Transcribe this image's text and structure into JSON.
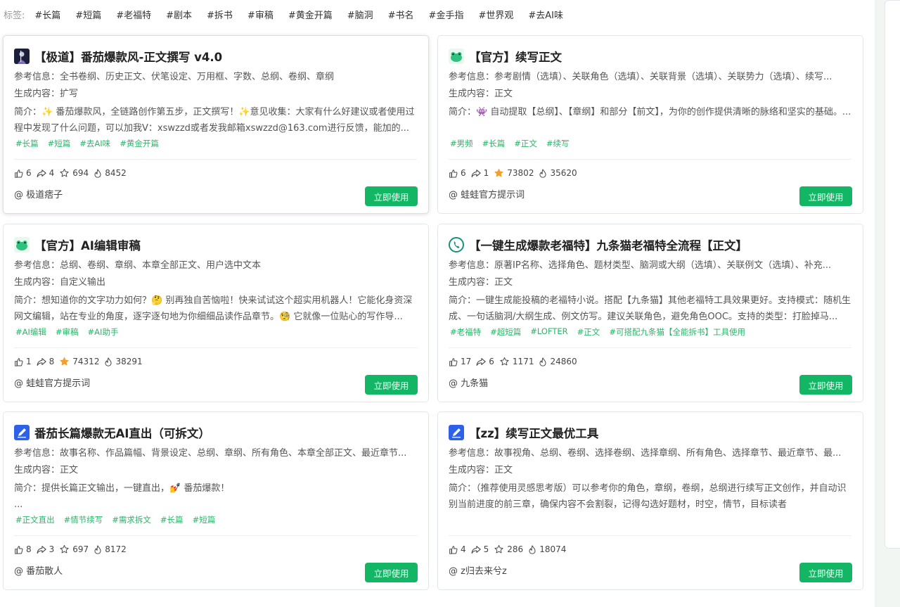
{
  "tags_bar": {
    "label": "标签:",
    "tags": [
      "#长篇",
      "#短篇",
      "#老福特",
      "#剧本",
      "#拆书",
      "#审稿",
      "#黄金开篇",
      "#脑洞",
      "#书名",
      "#金手指",
      "#世界观",
      "#去AI味"
    ]
  },
  "labels": {
    "ref": "参考信息：",
    "gen": "生成内容：",
    "intro": "简介：",
    "use_button": "立即使用"
  },
  "cards": [
    {
      "title": "【极道】番茄爆款风-正文撰写 v4.0",
      "icon": "dark-portrait-icon",
      "ref": "全书卷纲、历史正文、伏笔设定、万用框、字数、总纲、卷纲、章纲",
      "gen": "扩写",
      "intro": "✨ 番茄爆款风，全链路创作第五步，正文撰写！✨意见收集：大家有什么好建议或者使用过程中发现了什么问题，可以加我V：xswzzd或者发我邮箱xswzzd@163.com进行反馈，能加的...",
      "tags": [
        "#长篇",
        "#短篇",
        "#去AI味",
        "#黄金开篇"
      ],
      "likes": "6",
      "shares": "4",
      "stars": "694",
      "uses": "8452",
      "starred": false,
      "author": "@ 极道痞子"
    },
    {
      "title": "【官方】续写正文",
      "icon": "frog-icon",
      "ref": "参考剧情（选填）、关联角色（选填）、关联背景（选填）、关联势力（选填）、续写...",
      "gen": "正文",
      "intro": "👾 自动提取【总纲】、【章纲】和部分【前文】，为你的创作提供清晰的脉络和坚实的基础。...",
      "tags": [
        "#男频",
        "#长篇",
        "#正文",
        "#续写"
      ],
      "likes": "6",
      "shares": "1",
      "stars": "73802",
      "uses": "35620",
      "starred": true,
      "author": "@ 蛙蛙官方提示词"
    },
    {
      "title": "【官方】AI编辑审稿",
      "icon": "frog-icon",
      "ref": "总纲、卷纲、章纲、本章全部正文、用户选中文本",
      "gen": "自定义输出",
      "intro": "想知道你的文字功力如何？🤔 别再独自苦恼啦！快来试试这个超实用机器人！它能化身资深网文编辑，站在专业的角度，逐字逐句地为你细细品读作品章节。🧐 它就像一位贴心的写作导...",
      "tags": [
        "#AI编辑",
        "#审稿",
        "#AI助手"
      ],
      "likes": "1",
      "shares": "8",
      "stars": "74312",
      "uses": "38291",
      "starred": true,
      "author": "@ 蛙蛙官方提示词"
    },
    {
      "title": "【一键生成爆款老福特】九条猫老福特全流程【正文】",
      "icon": "cat-phone-icon",
      "ref": "原著IP名称、选择角色、题材类型、脑洞或大纲（选填）、关联例文（选填）、补充...",
      "gen": "正文",
      "intro": "一键生成能投稿的老福特小说。搭配【九条猫】其他老福特工具效果更好。支持模式：随机生成、一句话脑洞/大纲生成、例文仿写。建议关联角色，避免角色OOC。支持的类型：打脸掉马...",
      "tags": [
        "#老福特",
        "#超短篇",
        "#LOFTER",
        "#正文",
        "#可搭配九条猫【全能拆书】工具使用"
      ],
      "likes": "17",
      "shares": "6",
      "stars": "1171",
      "uses": "24860",
      "starred": false,
      "author": "@ 九条猫"
    },
    {
      "title": "番茄长篇爆款无AI直出（可拆文）",
      "icon": "pen-icon",
      "ref": "故事名称、作品篇幅、背景设定、总纲、章纲、所有角色、本章全部正文、最近章节...",
      "gen": "正文",
      "intro": "提供长篇正文输出，一键直出，💅 番茄爆款！\n...",
      "tags": [
        "#正文直出",
        "#情节续写",
        "#需求拆文",
        "#长篇",
        "#短篇"
      ],
      "likes": "8",
      "shares": "3",
      "stars": "697",
      "uses": "8172",
      "starred": false,
      "author": "@ 番茄散人"
    },
    {
      "title": "【zz】续写正文最优工具",
      "icon": "pen-icon",
      "ref": "故事视角、总纲、卷纲、选择卷纲、选择章纲、所有角色、选择章节、最近章节、最...",
      "gen": "正文",
      "intro": "（推荐使用灵感思考版）可以参考你的角色，章纲，卷纲，总纲进行续写正文创作，并自动识别当前进度的前三章，确保内容不会割裂，记得勾选好题材，时空，情节，目标读者",
      "tags": [],
      "likes": "4",
      "shares": "5",
      "stars": "286",
      "uses": "18074",
      "starred": false,
      "author": "@ z归去来兮z"
    }
  ],
  "colors": {
    "accent": "#12b664",
    "tag_green": "#2bb56a",
    "star_active": "#f0a030"
  }
}
